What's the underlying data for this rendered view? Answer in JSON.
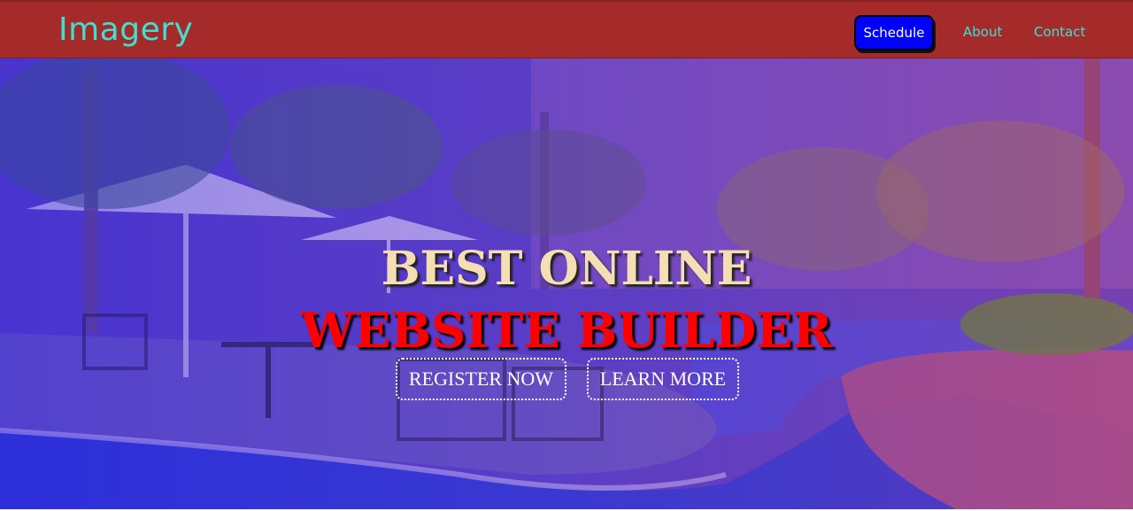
{
  "navbar": {
    "brand": "Imagery",
    "schedule_label": "Schedule",
    "about_label": "About",
    "contact_label": "Contact",
    "background_color": "#a52a2a",
    "link_color": "#40e0d0",
    "schedule_color": "#0000ff"
  },
  "hero": {
    "headline_line1": "BEST ONLINE",
    "headline_line2": "WEBSITE BUILDER",
    "register_label": "REGISTER NOW",
    "learn_label": "LEARN MORE",
    "headline1_color": "#f5deb3",
    "headline2_color": "#ff0000"
  }
}
